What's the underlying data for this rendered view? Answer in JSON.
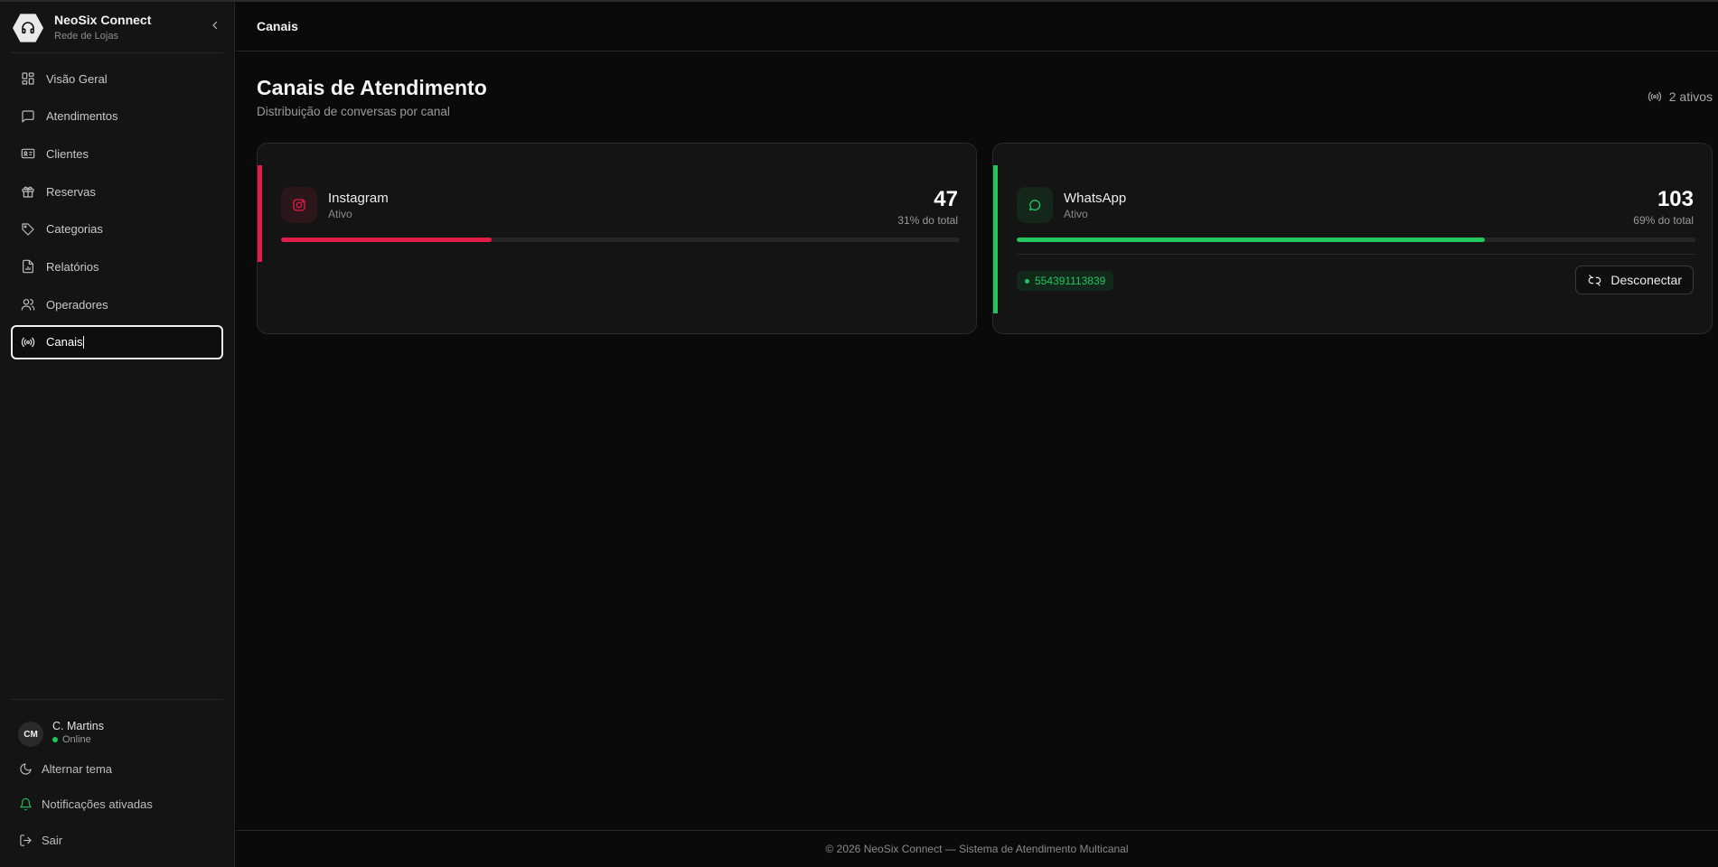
{
  "brand": {
    "title": "NeoSix Connect",
    "subtitle": "Rede de Lojas",
    "logo_icon": "headset-icon",
    "collapse_icon": "chevron-left-icon"
  },
  "sidebar": {
    "items": [
      {
        "label": "Visão Geral",
        "icon": "layout-grid-icon",
        "active": false
      },
      {
        "label": "Atendimentos",
        "icon": "message-square-icon",
        "active": false
      },
      {
        "label": "Clientes",
        "icon": "id-card-icon",
        "active": false
      },
      {
        "label": "Reservas",
        "icon": "gift-icon",
        "active": false
      },
      {
        "label": "Categorias",
        "icon": "tag-icon",
        "active": false
      },
      {
        "label": "Relatórios",
        "icon": "file-chart-icon",
        "active": false
      },
      {
        "label": "Operadores",
        "icon": "users-icon",
        "active": false
      },
      {
        "label": "Canais",
        "icon": "radio-icon",
        "active": true
      }
    ],
    "user": {
      "initials": "CM",
      "name": "C. Martins",
      "status": "Online"
    },
    "footer": [
      {
        "label": "Alternar tema",
        "icon": "moon-icon"
      },
      {
        "label": "Notificações ativadas",
        "icon": "bell-icon"
      },
      {
        "label": "Sair",
        "icon": "logout-icon"
      }
    ]
  },
  "header": {
    "breadcrumb": "Canais"
  },
  "page": {
    "title": "Canais de Atendimento",
    "subtitle": "Distribuição de conversas por canal",
    "active_count": "2 ativos"
  },
  "channels": [
    {
      "name": "Instagram",
      "status": "Ativo",
      "value": "47",
      "share_label": "31% do total",
      "share": 0.31,
      "color": "#e11d48",
      "icon_bg": "#2a161b",
      "icon": "instagram-icon"
    },
    {
      "name": "WhatsApp",
      "status": "Ativo",
      "value": "103",
      "share_label": "69% do total",
      "share": 0.69,
      "color": "#22c55e",
      "icon_bg": "#15261b",
      "icon": "whatsapp-icon",
      "phone": "554391113839",
      "disconnect_label": "Desconectar",
      "disconnect_icon": "unlink-icon"
    }
  ],
  "footer": {
    "text": "© 2026 NeoSix Connect — Sistema de Atendimento Multicanal"
  }
}
